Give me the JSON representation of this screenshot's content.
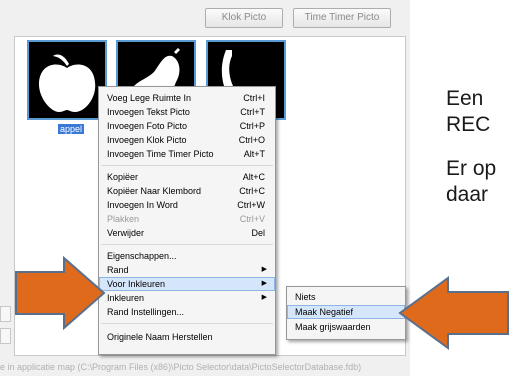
{
  "toolbar": {
    "buttons": [
      "Klok Picto",
      "Time Timer Picto"
    ]
  },
  "pictos": [
    {
      "label": "appel",
      "icon": "apple-icon",
      "selected": true
    },
    {
      "label": "",
      "icon": "pear-icon",
      "selected": false
    },
    {
      "label": "",
      "icon": "banana-icon",
      "selected": false
    }
  ],
  "context_menu": {
    "items": [
      {
        "label": "Voeg Lege Ruimte In",
        "shortcut": "Ctrl+I"
      },
      {
        "label": "Invoegen Tekst Picto",
        "shortcut": "Ctrl+T"
      },
      {
        "label": "Invoegen Foto Picto",
        "shortcut": "Ctrl+P"
      },
      {
        "label": "Invoegen Klok Picto",
        "shortcut": "Ctrl+O"
      },
      {
        "label": "Invoegen Time Timer Picto",
        "shortcut": "Alt+T"
      },
      {
        "label": "Kopiëer",
        "shortcut": "Alt+C"
      },
      {
        "label": "Kopiëer Naar Klembord",
        "shortcut": "Ctrl+C"
      },
      {
        "label": "Invoegen In Word",
        "shortcut": "Ctrl+W"
      },
      {
        "label": "Plakken",
        "shortcut": "Ctrl+V",
        "disabled": true
      },
      {
        "label": "Verwijder",
        "shortcut": "Del"
      },
      {
        "label": "Eigenschappen..."
      },
      {
        "label": "Rand",
        "submenu": true
      },
      {
        "label": "Voor Inkleuren",
        "submenu": true,
        "highlighted": true
      },
      {
        "label": "Inkleuren",
        "submenu": true
      },
      {
        "label": "Rand Instellingen..."
      },
      {
        "label": "Originele Naam Herstellen"
      }
    ]
  },
  "submenu": {
    "items": [
      {
        "label": "Niets"
      },
      {
        "label": "Maak Negatief",
        "highlighted": true
      },
      {
        "label": "Maak grijswaarden"
      }
    ]
  },
  "statusbar": {
    "text": "e in applicatie map (C:\\Program Files (x86)\\Picto Selector\\data\\PictoSelectorDatabase.fdb)"
  },
  "slide_text": {
    "line1": "Een",
    "line2": "REC",
    "line3": "Er op",
    "line4": "daar"
  },
  "colors": {
    "arrow": "#e06a1b",
    "arrow_border": "#5a6f8c",
    "highlight": "#d6e6fa",
    "selection": "#3a78d8"
  }
}
